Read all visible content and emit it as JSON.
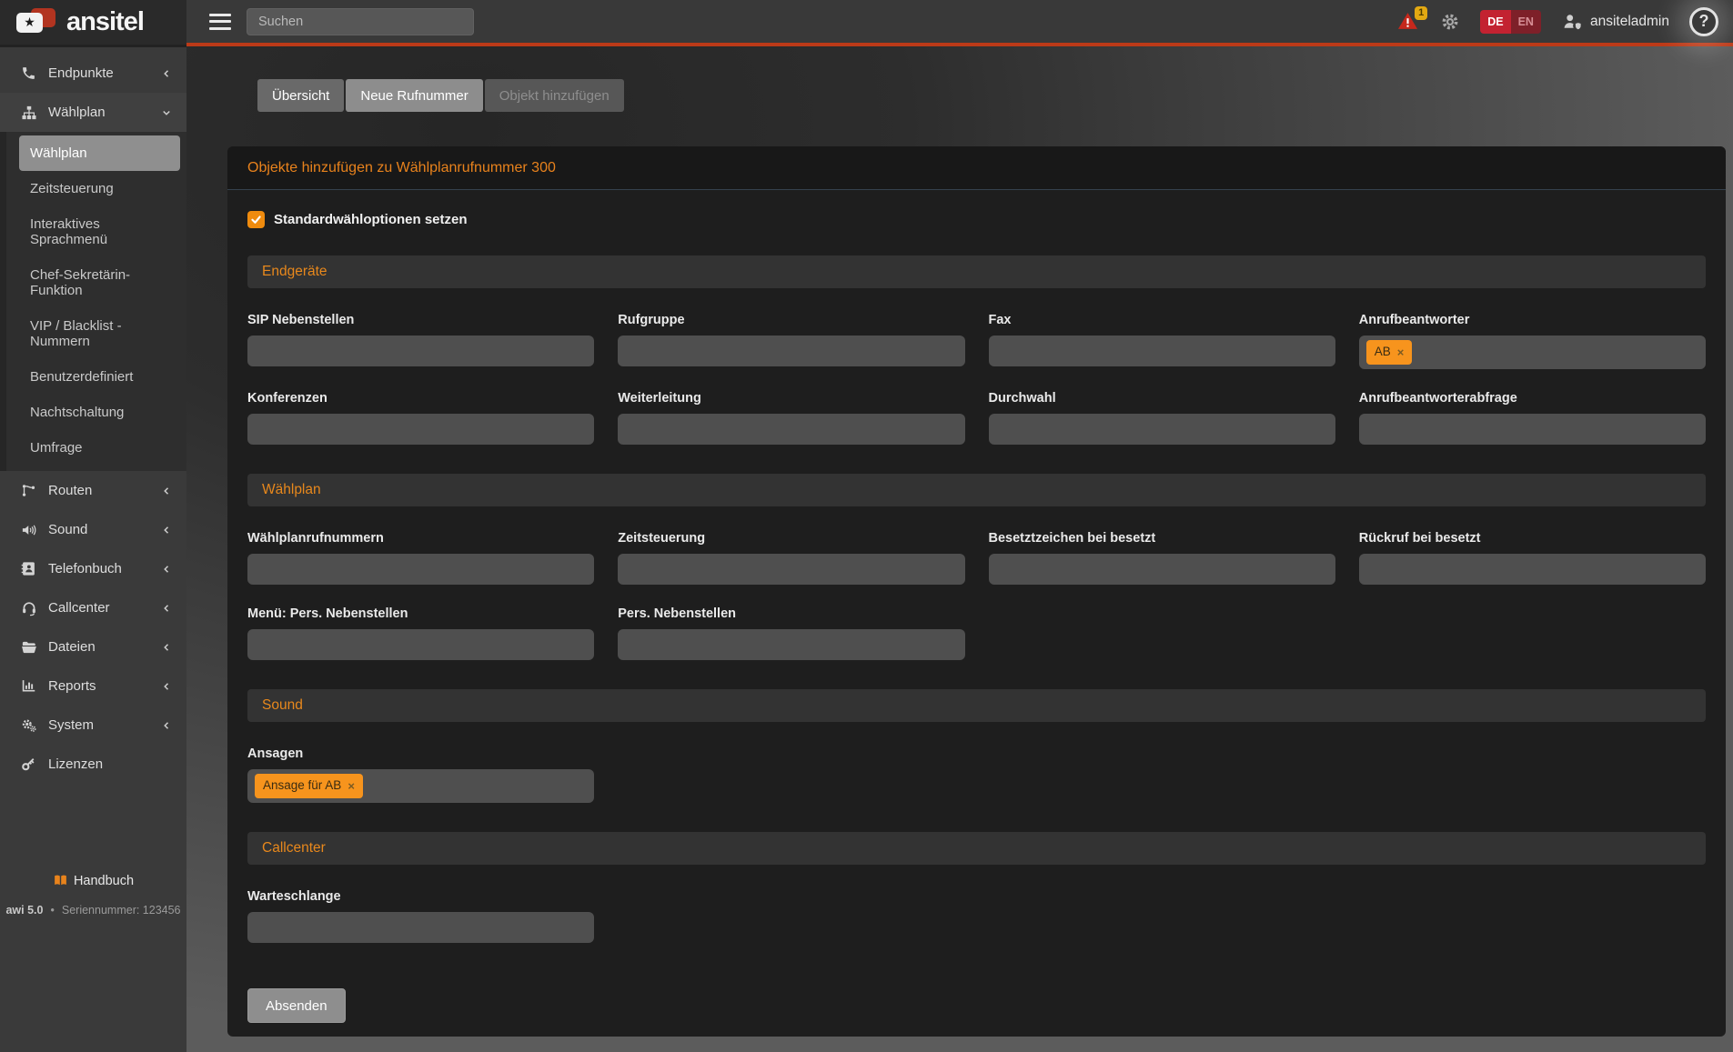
{
  "brand": {
    "name": "ansitel"
  },
  "glyphs": {
    "close": "×",
    "bullet": "•",
    "star": "★",
    "question": "?"
  },
  "topbar": {
    "search_placeholder": "Suchen",
    "alerts_badge": "1",
    "lang_de": "DE",
    "lang_en": "EN",
    "username": "ansiteladmin"
  },
  "sidebar": {
    "items": [
      {
        "label": "Endpunkte",
        "icon": "phone-icon",
        "state": "collapsed"
      },
      {
        "label": "Wählplan",
        "icon": "sitemap-icon",
        "state": "expanded",
        "children": [
          {
            "label": "Wählplan",
            "active": true
          },
          {
            "label": "Zeitsteuerung",
            "active": false
          },
          {
            "label": "Interaktives Sprachmenü",
            "active": false
          },
          {
            "label": "Chef-Sekretärin-Funktion",
            "active": false
          },
          {
            "label": "VIP / Blacklist - Nummern",
            "active": false
          },
          {
            "label": "Benutzerdefiniert",
            "active": false
          },
          {
            "label": "Nachtschaltung",
            "active": false
          },
          {
            "label": "Umfrage",
            "active": false
          }
        ]
      },
      {
        "label": "Routen",
        "icon": "routes-icon",
        "state": "collapsed"
      },
      {
        "label": "Sound",
        "icon": "volume-icon",
        "state": "collapsed"
      },
      {
        "label": "Telefonbuch",
        "icon": "address-book-icon",
        "state": "collapsed"
      },
      {
        "label": "Callcenter",
        "icon": "headset-icon",
        "state": "collapsed"
      },
      {
        "label": "Dateien",
        "icon": "folder-open-icon",
        "state": "collapsed"
      },
      {
        "label": "Reports",
        "icon": "chart-bar-icon",
        "state": "collapsed"
      },
      {
        "label": "System",
        "icon": "gears-icon",
        "state": "collapsed"
      },
      {
        "label": "Lizenzen",
        "icon": "key-icon",
        "state": "collapsed"
      }
    ],
    "footer": {
      "manual_label": "Handbuch",
      "version": "awi 5.0",
      "serial": "Seriennummer: 123456"
    }
  },
  "tabs": [
    {
      "label": "Übersicht",
      "state": "normal"
    },
    {
      "label": "Neue Rufnummer",
      "state": "active"
    },
    {
      "label": "Objekt hinzufügen",
      "state": "disabled"
    }
  ],
  "panel": {
    "title": "Objekte hinzufügen zu Wählplanrufnummer 300",
    "checkbox": {
      "label": "Standardwähloptionen setzen",
      "checked": true
    },
    "sections": [
      {
        "title": "Endgeräte",
        "fields": [
          {
            "label": "SIP Nebenstellen",
            "value": "",
            "tags": []
          },
          {
            "label": "Rufgruppe",
            "value": "",
            "tags": []
          },
          {
            "label": "Fax",
            "value": "",
            "tags": []
          },
          {
            "label": "Anrufbeantworter",
            "value": "",
            "tags": [
              "AB"
            ]
          },
          {
            "label": "Konferenzen",
            "value": "",
            "tags": []
          },
          {
            "label": "Weiterleitung",
            "value": "",
            "tags": []
          },
          {
            "label": "Durchwahl",
            "value": "",
            "tags": []
          },
          {
            "label": "Anrufbeantworterabfrage",
            "value": "",
            "tags": []
          }
        ]
      },
      {
        "title": "Wählplan",
        "fields": [
          {
            "label": "Wählplanrufnummern",
            "value": "",
            "tags": []
          },
          {
            "label": "Zeitsteuerung",
            "value": "",
            "tags": []
          },
          {
            "label": "Besetztzeichen bei besetzt",
            "value": "",
            "tags": []
          },
          {
            "label": "Rückruf bei besetzt",
            "value": "",
            "tags": []
          },
          {
            "label": "Menü: Pers. Nebenstellen",
            "value": "",
            "tags": []
          },
          {
            "label": "Pers. Nebenstellen",
            "value": "",
            "tags": []
          }
        ]
      },
      {
        "title": "Sound",
        "fields": [
          {
            "label": "Ansagen",
            "value": "",
            "tags": [
              "Ansage für AB"
            ]
          }
        ]
      },
      {
        "title": "Callcenter",
        "fields": [
          {
            "label": "Warteschlange",
            "value": "",
            "tags": []
          }
        ]
      }
    ],
    "submit_label": "Absenden"
  },
  "colors": {
    "accent_orange": "#e8821c",
    "tag_orange": "#f7941d",
    "topbar_line": "#bc3a18",
    "lang_de_red": "#c32231",
    "warning_red": "#c5281c",
    "badge_yellow": "#e3a912",
    "checkbox_orange": "#ef8b0e"
  }
}
